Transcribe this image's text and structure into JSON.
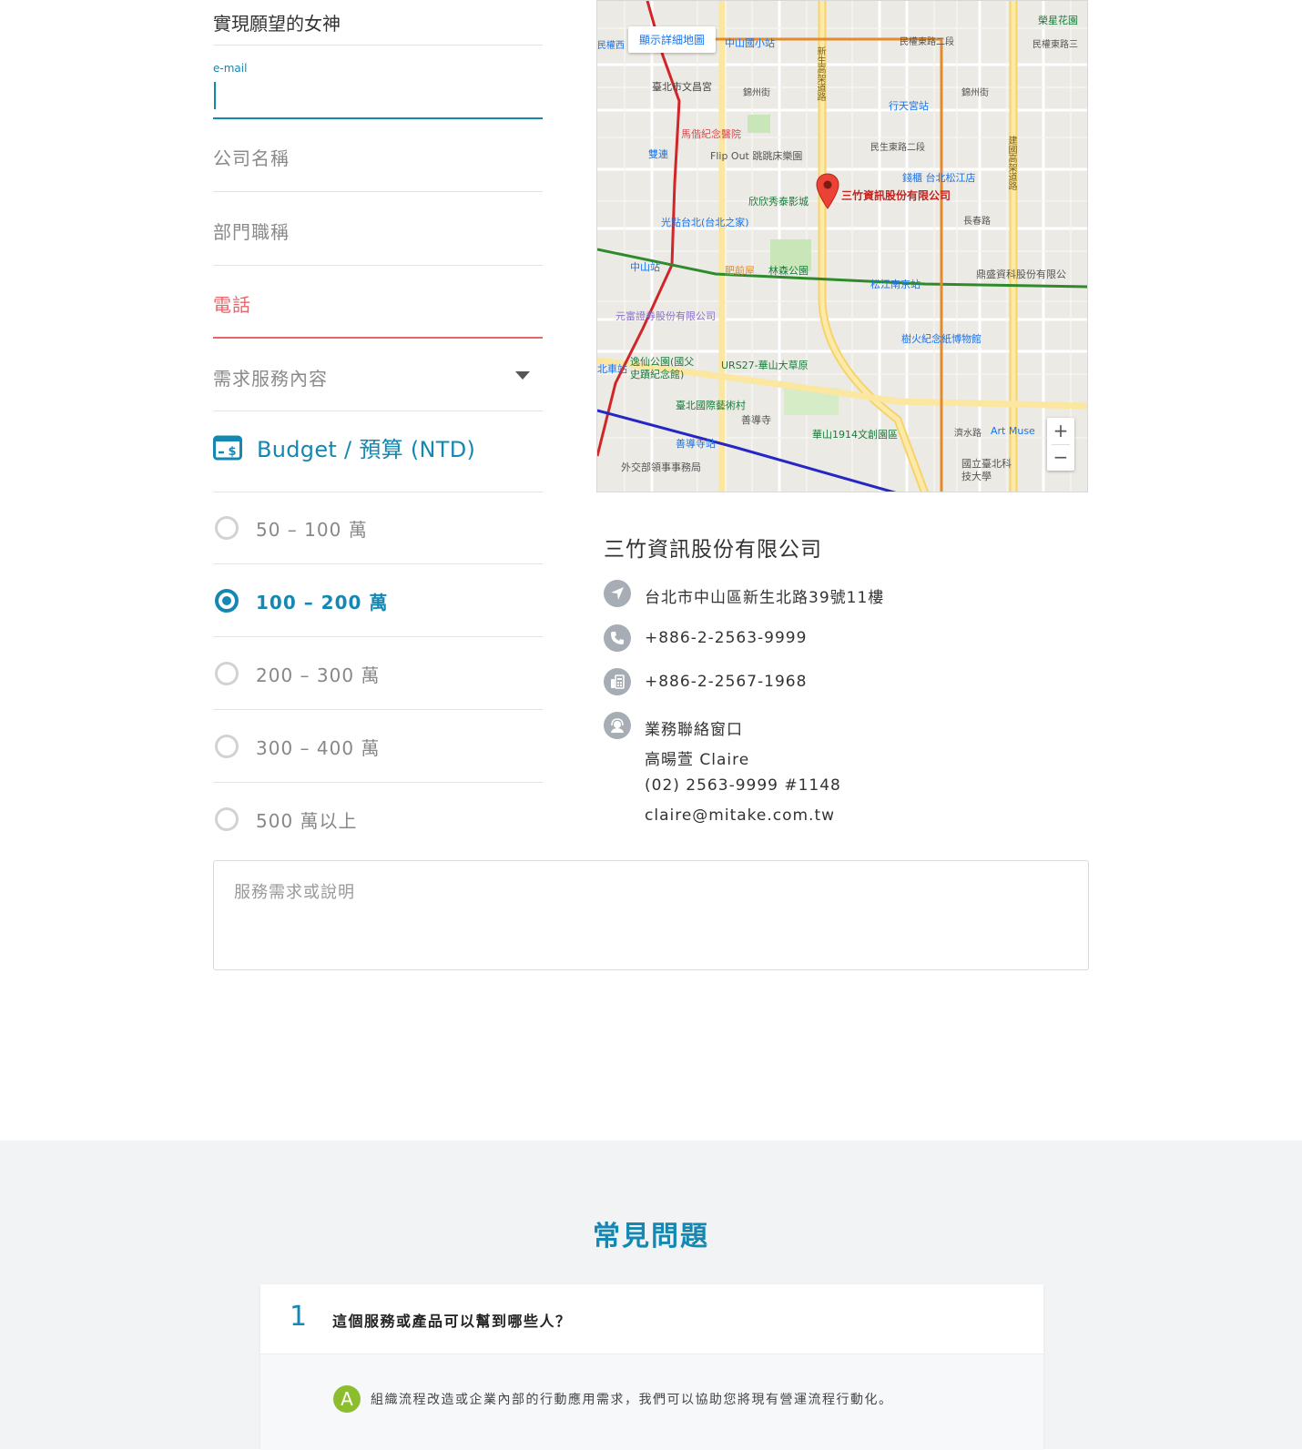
{
  "form": {
    "name_value": "實現願望的女神",
    "email_label": "e-mail",
    "company_placeholder": "公司名稱",
    "department_placeholder": "部門職稱",
    "phone_placeholder": "電話",
    "service_select_placeholder": "需求服務內容",
    "budget_title": "Budget / 預算 (NTD)",
    "budget_options": [
      {
        "label": "50 – 100 萬",
        "checked": false
      },
      {
        "label": "100 – 200 萬",
        "checked": true
      },
      {
        "label": "200 – 300 萬",
        "checked": false
      },
      {
        "label": "300 – 400 萬",
        "checked": false
      },
      {
        "label": "500 萬以上",
        "checked": false
      }
    ],
    "note_placeholder": "服務需求或說明"
  },
  "map": {
    "detail_button": "顯示詳細地圖",
    "zoom_in": "+",
    "zoom_out": "−",
    "marker_label": "三竹資訊股份有限公司",
    "labels": {
      "l1": "中山國小站",
      "l2": "民權東路二段",
      "l3": "臺北市文昌宮",
      "l4": "錦州街",
      "l5": "行天宮站",
      "l6": "錦州街",
      "l7": "馬偕紀念醫院",
      "l8": "雙連",
      "l9": "Flip Out 跳跳床樂園",
      "l10": "民生東路二段",
      "l11": "錢櫃 台北松江店",
      "l12": "欣欣秀泰影城",
      "l13": "光點台北(台北之家)",
      "l14": "長春路",
      "l15": "中山站",
      "l16": "肥前屋",
      "l17": "林森公園",
      "l18": "松江南京站",
      "l19": "鼎盛資科股份有限公",
      "l20": "元富證券股份有限公司",
      "l21": "樹火紀念紙博物館",
      "l22": "逸仙公園(國父史蹟紀念館)",
      "l23": "URS27-華山大草原",
      "l24": "臺北國際藝術村",
      "l25": "善導寺",
      "l26": "善導寺站",
      "l27": "華山1914文創園區",
      "l28": "濟水路",
      "l29": "Art Muse",
      "l30": "外交部領事事務局",
      "l31": "國立臺北科技大學",
      "l32": "新生高架道路",
      "l33": "建國高架道路",
      "l34": "民權西",
      "l35": "北車站",
      "l36": "榮星花園",
      "l37": "民權東路三"
    }
  },
  "contact": {
    "company": "三竹資訊股份有限公司",
    "address": "台北市中山區新生北路39號11樓",
    "phone": "+886-2-2563-9999",
    "fax": "+886-2-2567-1968",
    "sales_title": "業務聯絡窗口",
    "sales_name": "高暘萱 Claire",
    "sales_phone": "(02) 2563-9999 #1148",
    "sales_email": "claire@mitake.com.tw"
  },
  "faq": {
    "title": "常見問題",
    "items": [
      {
        "number": "1",
        "question": "這個服務或產品可以幫到哪些人？",
        "answer_badge": "A",
        "answer": "組織流程改造或企業內部的行動應用需求，我們可以協助您將現有營運流程行動化。"
      }
    ]
  },
  "colors": {
    "accent": "#1488b3",
    "error": "#e8646b",
    "answer_badge": "#8cbd2f",
    "faq_bg": "#f2f3f5"
  },
  "icons": [
    "budget-card-icon",
    "location-arrow-icon",
    "phone-icon",
    "fax-icon",
    "support-agent-icon",
    "map-marker-icon",
    "caret-down-icon"
  ]
}
